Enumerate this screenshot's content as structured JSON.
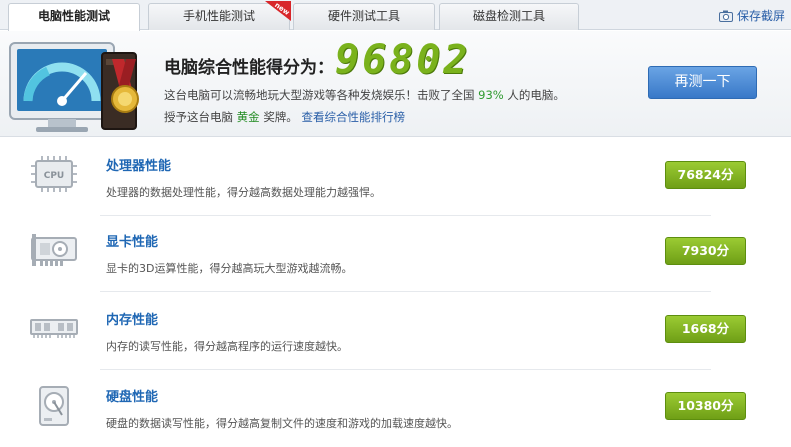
{
  "tabs": [
    {
      "label": "电脑性能测试",
      "active": true
    },
    {
      "label": "手机性能测试",
      "badge": "new"
    },
    {
      "label": "硬件测试工具"
    },
    {
      "label": "磁盘检测工具"
    }
  ],
  "save_screenshot_label": "保存截屏",
  "header": {
    "score_title": "电脑综合性能得分为：",
    "score_value": "96802",
    "desc_prefix": "这台电脑可以流畅地玩大型游戏等各种发烧娱乐！击败了全国",
    "desc_percent": "93%",
    "desc_suffix": "人的电脑。",
    "award_prefix": "授予这台电脑",
    "award_medal": "黄金",
    "award_suffix": "奖牌。",
    "rank_link": "查看综合性能排行榜",
    "retest_label": "再测一下"
  },
  "rows": [
    {
      "title": "处理器性能",
      "desc": "处理器的数据处理性能，得分越高数据处理能力越强悍。",
      "score": "76824分",
      "icon": "cpu-icon"
    },
    {
      "title": "显卡性能",
      "desc": "显卡的3D运算性能，得分越高玩大型游戏越流畅。",
      "score": "7930分",
      "icon": "graphics-card-icon"
    },
    {
      "title": "内存性能",
      "desc": "内存的读写性能，得分越高程序的运行速度越快。",
      "score": "1668分",
      "icon": "memory-icon"
    },
    {
      "title": "硬盘性能",
      "desc": "硬盘的数据读写性能，得分越高复制文件的速度和游戏的加载速度越快。",
      "score": "10380分",
      "icon": "hard-disk-icon"
    }
  ],
  "colors": {
    "score_green": "#7ab21c",
    "link_blue": "#1f67b4",
    "button_blue": "#3878c8",
    "badge_red": "#d8262a"
  }
}
